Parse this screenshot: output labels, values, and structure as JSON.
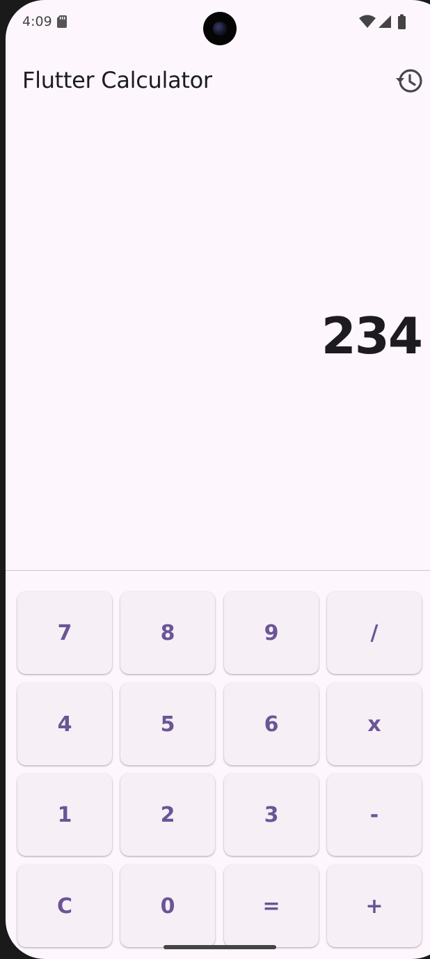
{
  "status_bar": {
    "time": "4:09"
  },
  "app_bar": {
    "title": "Flutter Calculator",
    "history_icon": "history-icon"
  },
  "display": {
    "value": "234"
  },
  "keypad": {
    "rows": [
      [
        "7",
        "8",
        "9",
        "/"
      ],
      [
        "4",
        "5",
        "6",
        "x"
      ],
      [
        "1",
        "2",
        "3",
        "-"
      ],
      [
        "C",
        "0",
        "=",
        "+"
      ]
    ]
  },
  "colors": {
    "background": "#fdf7fd",
    "key_background": "#f6eff6",
    "key_text": "#6a5596",
    "display_text": "#1d1b20",
    "divider": "#cac4d0"
  }
}
